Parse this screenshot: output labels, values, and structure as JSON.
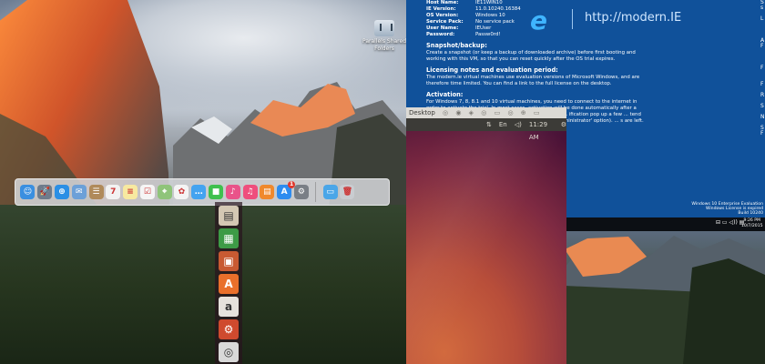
{
  "mac": {
    "desktop_icon_label": "Parallels Shared Folders",
    "dock_apps": [
      {
        "name": "finder",
        "color": "#3a8fe0",
        "glyph": "☺"
      },
      {
        "name": "launchpad",
        "color": "#6e7c8c",
        "glyph": "🚀"
      },
      {
        "name": "safari",
        "color": "#2b8fe5",
        "glyph": "⊕"
      },
      {
        "name": "mail",
        "color": "#6ca0d8",
        "glyph": "✉"
      },
      {
        "name": "contacts",
        "color": "#b08a5a",
        "glyph": "☰"
      },
      {
        "name": "calendar",
        "color": "#f2f2f2",
        "glyph": "7"
      },
      {
        "name": "notes",
        "color": "#f7e9a0",
        "glyph": "≡"
      },
      {
        "name": "reminders",
        "color": "#f5f5f5",
        "glyph": "☑"
      },
      {
        "name": "maps",
        "color": "#8fc47a",
        "glyph": "⌖"
      },
      {
        "name": "photos",
        "color": "#f4f4f4",
        "glyph": "✿"
      },
      {
        "name": "messages",
        "color": "#43a3f0",
        "glyph": "…"
      },
      {
        "name": "facetime",
        "color": "#3fc04e",
        "glyph": "■"
      },
      {
        "name": "itunes-ish",
        "color": "#e9538a",
        "glyph": "♪"
      },
      {
        "name": "itunes",
        "color": "#ef4e7d",
        "glyph": "♫"
      },
      {
        "name": "ibooks",
        "color": "#f0892d",
        "glyph": "▤"
      },
      {
        "name": "app-store",
        "color": "#2d8cf0",
        "glyph": "A",
        "badge": "1"
      },
      {
        "name": "system-preferences",
        "color": "#7a7f86",
        "glyph": "⚙"
      }
    ],
    "dock_right": [
      {
        "name": "downloads",
        "color": "#4aa6e8",
        "glyph": "▭"
      },
      {
        "name": "trash",
        "color": "#c9ccd0",
        "glyph": "🗑"
      }
    ]
  },
  "windows": {
    "info": [
      {
        "k": "Host Name:",
        "v": "IE11WIN10"
      },
      {
        "k": "IE Version:",
        "v": "11.0.10240.16384"
      },
      {
        "k": "OS Version:",
        "v": "Windows 10"
      },
      {
        "k": "Service Pack:",
        "v": "No service pack"
      },
      {
        "k": "User Name:",
        "v": "IEUser"
      },
      {
        "k": "Password:",
        "v": "Passw0rd!"
      }
    ],
    "sections": [
      {
        "h": "Snapshot/backup:",
        "p": "Create a snapshot (or keep a backup of downloaded archive) before first booting and working with this VM, so that you can reset quickly after the OS trial expires."
      },
      {
        "h": "Licensing notes and evaluation period:",
        "p": "The modern.ie virtual machines use evaluation versions of Microsoft Windows, and are therefore time limited. You can find a link to the full license on the desktop."
      },
      {
        "h": "Activation:",
        "p": "For Windows 7, 8, 8.1 and 10 virtual machines, you need to connect to the internet in order to activate the trial. In most cases, activation will be done automatically after a few minutes, but you can ... This will give you 90 days. ... ification pop up a few ... tend the initial trial period if ... administrator command ... Administrator' option). ... s are left."
      }
    ],
    "ie_url": "http://modern.IE",
    "build": [
      "Windows 10 Enterprise Evaluation",
      "Windows License is expired",
      "Build 10240"
    ],
    "clock_time": "9:26 PM",
    "clock_date": "10/7/2015"
  },
  "ubuntu": {
    "window_title": "Desktop",
    "clock": "11:29 AM",
    "launcher": [
      {
        "name": "files-app",
        "color": "#d4c8b4",
        "glyph": "▤"
      },
      {
        "name": "libreoffice-calc",
        "color": "#3d9b46",
        "glyph": "▦"
      },
      {
        "name": "libreoffice-impress",
        "color": "#c85a32",
        "glyph": "▣"
      },
      {
        "name": "ubuntu-software",
        "color": "#e9702b",
        "glyph": "A"
      },
      {
        "name": "amazon",
        "color": "#e6e2dc",
        "glyph": "a"
      },
      {
        "name": "system-settings",
        "color": "#cf4a2e",
        "glyph": "⚙"
      },
      {
        "name": "dvd",
        "color": "#d8d8d8",
        "glyph": "◎"
      }
    ]
  }
}
